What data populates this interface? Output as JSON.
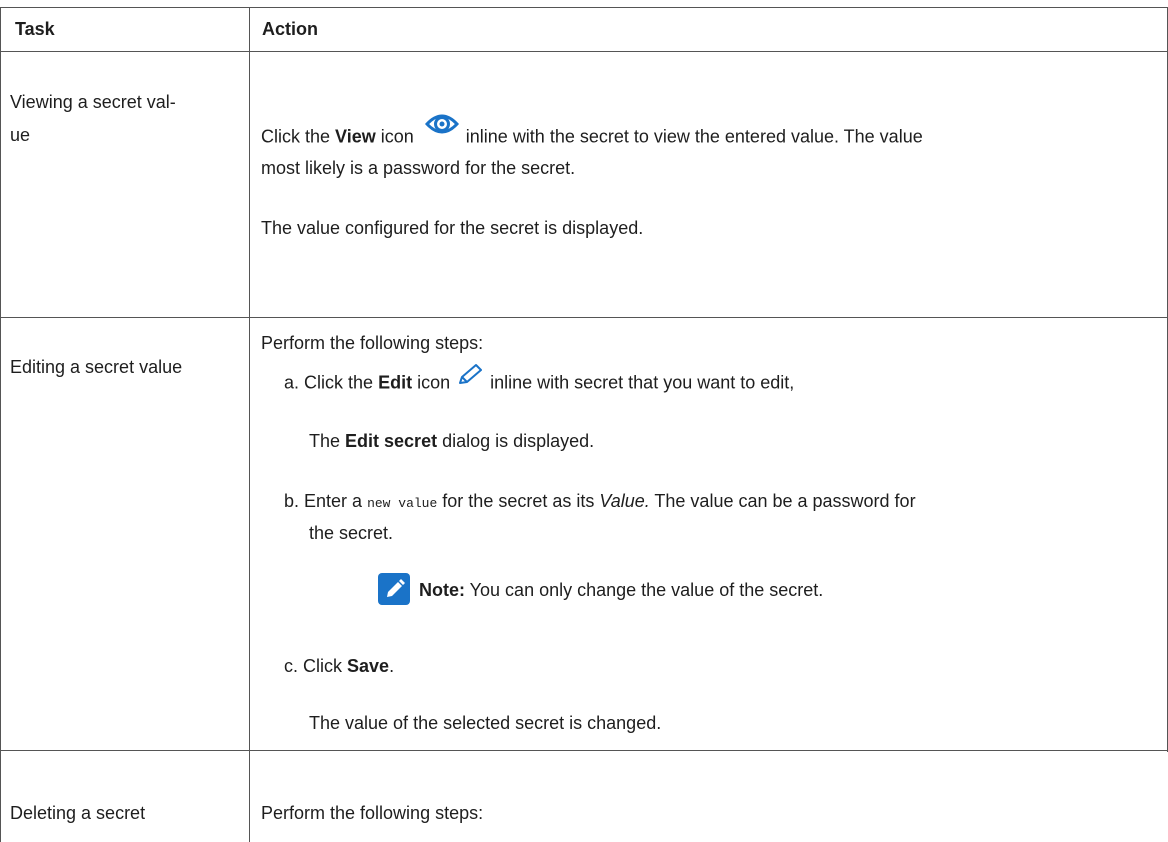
{
  "table": {
    "headers": {
      "task": "Task",
      "action": "Action"
    },
    "rows": [
      {
        "task_line1": "Viewing a secret val-",
        "task_line2": "ue",
        "p1_a": "Click the ",
        "p1_b": "View",
        "p1_c": " icon",
        "p1_d": " inline with the secret to view the entered value. The value",
        "p1_line2": "most likely is a password for the secret.",
        "p2": "The value configured for the secret is displayed.",
        "icon": "eye-icon"
      },
      {
        "task": "Editing a secret value",
        "intro": "Perform the following steps:",
        "step_a": {
          "marker": "a.",
          "t1": "Click the ",
          "t2": "Edit",
          "t3": " icon",
          "t4": " inline with secret that you want to edit,",
          "icon": "pencil-icon",
          "result_1": "The ",
          "result_2": "Edit secret",
          "result_3": " dialog is displayed."
        },
        "step_b": {
          "marker": "b.",
          "t1": "Enter a ",
          "code": "new value",
          "t2": " for the secret as its ",
          "t3": "Value.",
          "t4": " The value can be a password for",
          "line2": "the secret.",
          "note_label": "Note:",
          "note_text": " You can only change the value of the secret.",
          "note_icon": "note-pencil-icon"
        },
        "step_c": {
          "marker": "c.",
          "t1": "Click ",
          "t2": "Save",
          "t3": ".",
          "result": "The value of the selected secret is changed."
        }
      },
      {
        "task": "Deleting a secret",
        "intro": "Perform the following steps:"
      }
    ]
  },
  "colors": {
    "border": "#555555",
    "icon_blue": "#1a73c8",
    "text": "#1e1e1e"
  }
}
